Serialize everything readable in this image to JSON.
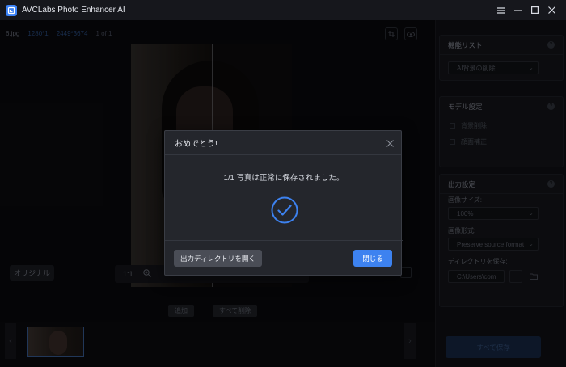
{
  "app": {
    "title": "AVCLabs Photo Enhancer AI"
  },
  "window_controls": [
    "menu-icon",
    "minimize-icon",
    "maximize-icon",
    "close-icon"
  ],
  "workspace": {
    "file_name": "6.jpg",
    "file_dims": "1280*1",
    "file_dims2": "2449*3674",
    "file_count": "1 of 1",
    "original_label": "オリジナル",
    "zoom_label": "1:1",
    "add_button": "追加",
    "remove_all_button": "すべて削除"
  },
  "sidebar": {
    "feature_section": {
      "title": "機能リスト",
      "selected": "AI背景の削除"
    },
    "model_section": {
      "title": "モデル設定",
      "options": [
        "背景削除",
        "顔面補正"
      ]
    },
    "output_section": {
      "title": "出力設定",
      "size_label": "画像サイズ:",
      "size_value": "100%",
      "format_label": "画像形式:",
      "format_value": "Preserve source format",
      "dir_label": "ディレクトリを保存:",
      "dir_value": "C:\\Users\\com"
    },
    "save_all_button": "すべて保存"
  },
  "dialog": {
    "title": "おめでとう!",
    "message": "1/1 写真は正常に保存されました。",
    "open_dir_button": "出力ディレクトリを開く",
    "close_button": "閉じる"
  },
  "colors": {
    "accent": "#3d82f0",
    "dialog_bg": "#24262c",
    "background": "#0e0e12"
  }
}
